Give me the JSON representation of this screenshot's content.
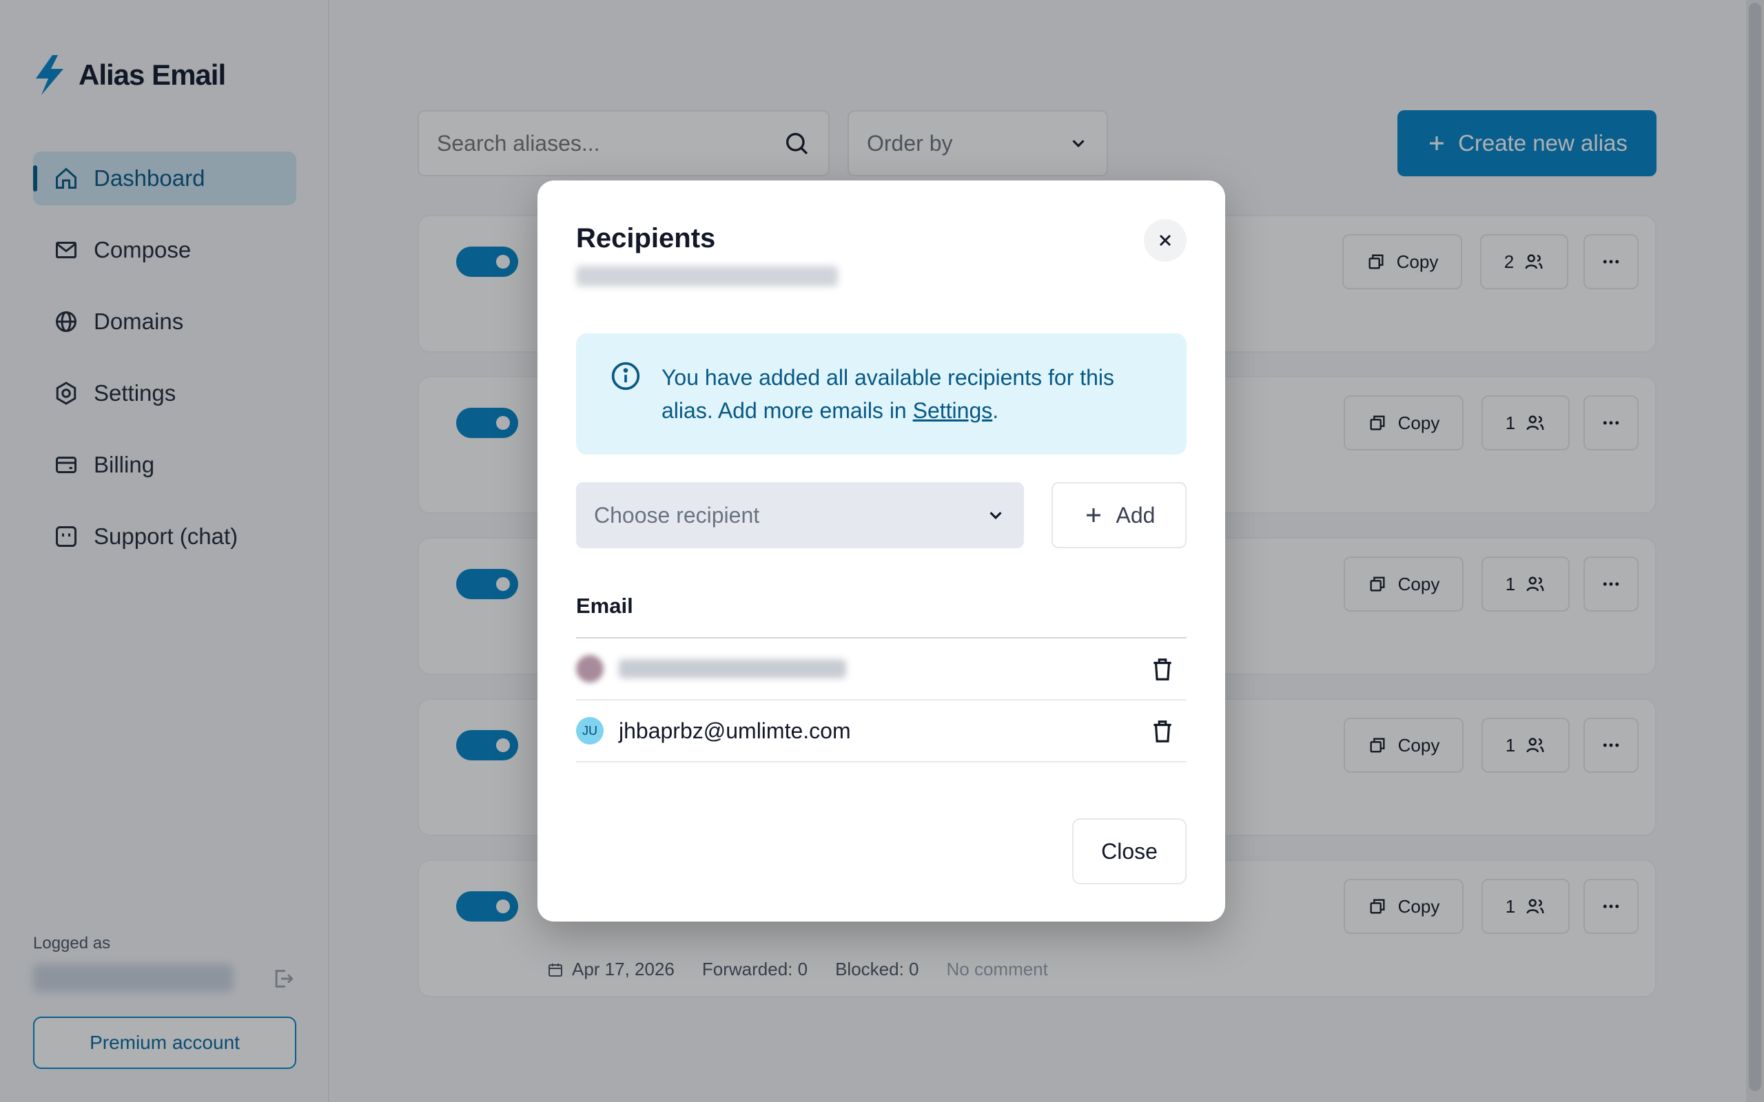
{
  "app": {
    "name": "Alias Email",
    "brand_color": "#0284c7"
  },
  "sidebar": {
    "items": [
      {
        "label": "Dashboard",
        "icon": "home-icon",
        "active": true
      },
      {
        "label": "Compose",
        "icon": "mail-icon"
      },
      {
        "label": "Domains",
        "icon": "globe-icon"
      },
      {
        "label": "Settings",
        "icon": "gear-icon"
      },
      {
        "label": "Billing",
        "icon": "wallet-icon"
      },
      {
        "label": "Support (chat)",
        "icon": "chat-icon"
      }
    ],
    "logged_as_label": "Logged as",
    "premium_label": "Premium account"
  },
  "toolbar": {
    "search_placeholder": "Search aliases...",
    "order_by_label": "Order by",
    "create_label": "Create new alias"
  },
  "aliases": [
    {
      "copy_label": "Copy",
      "recipient_count": "2"
    },
    {
      "copy_label": "Copy",
      "recipient_count": "1"
    },
    {
      "copy_label": "Copy",
      "recipient_count": "1"
    },
    {
      "copy_label": "Copy",
      "recipient_count": "1"
    },
    {
      "copy_label": "Copy",
      "recipient_count": "1",
      "date": "Apr 17, 2026",
      "forwarded": "Forwarded: 0",
      "blocked": "Blocked: 0",
      "comment": "No comment"
    }
  ],
  "modal": {
    "title": "Recipients",
    "alert_text": "You have added all available recipients for this alias. Add more emails in ",
    "alert_link": "Settings",
    "alert_end": ".",
    "choose_placeholder": "Choose recipient",
    "add_label": "Add",
    "email_header": "Email",
    "recipients": [
      {
        "email": "",
        "avatar": "",
        "blurred": true
      },
      {
        "email": "jhbaprbz@umlimte.com",
        "avatar": "JU",
        "blurred": false
      }
    ],
    "close_label": "Close"
  }
}
